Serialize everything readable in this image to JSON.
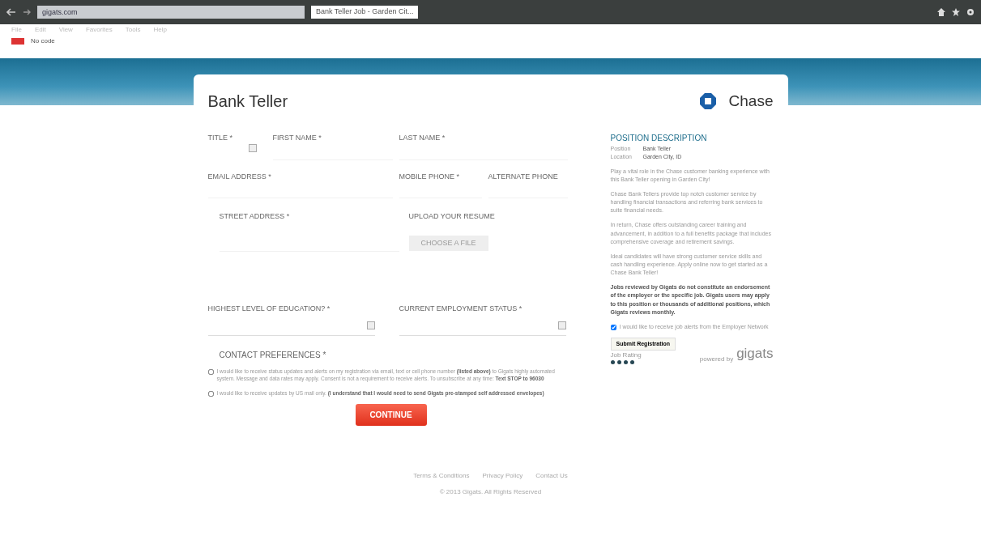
{
  "browser": {
    "url": "gigats.com",
    "tab_title": "Bank Teller Job - Garden Cit...",
    "menu": [
      "File",
      "Edit",
      "View",
      "Favorites",
      "Tools",
      "Help"
    ],
    "toolbar_text": "No code"
  },
  "header": {
    "title": "Bank Teller",
    "company": "Chase"
  },
  "form": {
    "rows": [
      {
        "fields": [
          {
            "kind": "select",
            "label": "TITLE *"
          },
          {
            "kind": "text",
            "label": "FIRST NAME *"
          },
          {
            "kind": "text",
            "label": "LAST NAME *"
          }
        ]
      },
      {
        "fields": [
          {
            "kind": "text",
            "label": "EMAIL ADDRESS *"
          },
          {
            "kind": "text",
            "label": "MOBILE PHONE *"
          },
          {
            "kind": "text",
            "label": "ALTERNATE PHONE"
          }
        ]
      }
    ],
    "street_label": "STREET ADDRESS *",
    "upload_label": "UPLOAD YOUR RESUME",
    "upload_button": "CHOOSE A FILE",
    "selects": [
      {
        "label": "HIGHEST LEVEL OF EDUCATION? *"
      },
      {
        "label": "CURRENT EMPLOYMENT STATUS *"
      }
    ],
    "contact_label": "CONTACT PREFERENCES *",
    "contact_options": [
      {
        "text": "I would like to receive status updates and alerts on my registration via email, text or cell phone number **(listed above)** to Gigats highly automated system. Message and data rates may apply. Consent is not a requirement to receive alerts. To unsubscribe at any time: **Text STOP to 96030**",
        "checked": false
      },
      {
        "text": "I would like to receive updates by US mail only. **(I understand that I would need to send Gigats pre-stamped self addressed envelopes)**",
        "checked": false
      }
    ],
    "submit": "CONTINUE"
  },
  "sidebar": {
    "heading": "POSITION DESCRIPTION",
    "details": [
      {
        "key": "Position",
        "value": "Bank Teller"
      },
      {
        "key": "Location",
        "value": "Garden City, ID"
      }
    ],
    "paragraphs": [
      "Play a vital role in the Chase customer banking experience with this Bank Teller opening in Garden City!",
      "Chase Bank Tellers provide top notch customer service by handling financial transactions and referring bank services to suite financial needs.",
      "In return, Chase offers outstanding career training and advancement, in addition to a full benefits package that includes comprehensive coverage and retirement savings.",
      "Ideal candidates will have strong customer service skills and cash handling experience. Apply online now to get started as a Chase Bank Teller!"
    ],
    "disclaimer": "Jobs reviewed by Gigats do not constitute an endorsement of the employer or the specific job. Gigats users may apply to this position or thousands of additional positions, which Gigats reviews monthly.",
    "alerts": {
      "text": "I would like to receive job alerts from the Employer Network",
      "checked": true
    },
    "register_button": "Submit Registration",
    "rating_label": "Job Rating",
    "stars": 4,
    "powered_by": "powered by",
    "brand": "gigats"
  },
  "footer": {
    "links": [
      "Terms & Conditions",
      "Privacy Policy",
      "Contact Us"
    ],
    "copyright": "© 2013 Gigats. All Rights Reserved"
  }
}
